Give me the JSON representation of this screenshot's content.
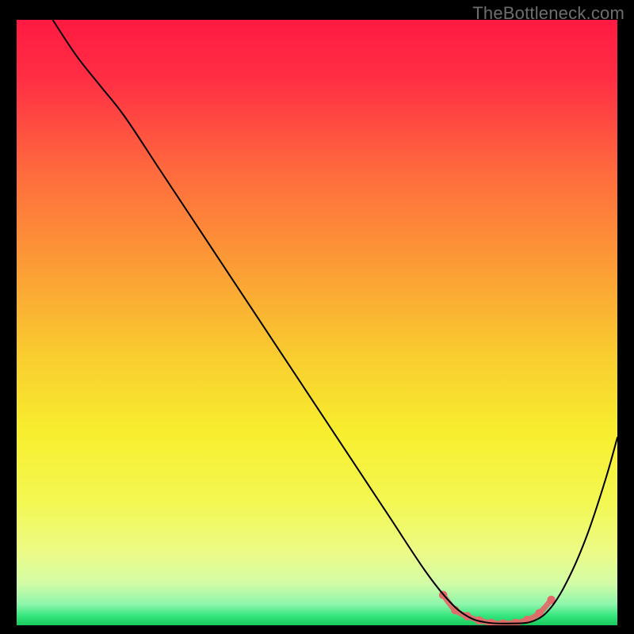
{
  "watermark": "TheBottleneck.com",
  "chart_data": {
    "type": "line",
    "title": "",
    "xlabel": "",
    "ylabel": "",
    "xlim": [
      0,
      100
    ],
    "ylim": [
      0,
      100
    ],
    "background_gradient": {
      "stops": [
        {
          "offset": 0.0,
          "color": "#ff1a42"
        },
        {
          "offset": 0.1,
          "color": "#ff2f44"
        },
        {
          "offset": 0.25,
          "color": "#ff6a3e"
        },
        {
          "offset": 0.4,
          "color": "#fc9a36"
        },
        {
          "offset": 0.55,
          "color": "#f9cb2f"
        },
        {
          "offset": 0.68,
          "color": "#f8ee2e"
        },
        {
          "offset": 0.8,
          "color": "#f3f854"
        },
        {
          "offset": 0.88,
          "color": "#ecfb87"
        },
        {
          "offset": 0.93,
          "color": "#d4fca5"
        },
        {
          "offset": 0.965,
          "color": "#8ef6ab"
        },
        {
          "offset": 0.985,
          "color": "#33e57c"
        },
        {
          "offset": 1.0,
          "color": "#18c95c"
        }
      ]
    },
    "series": [
      {
        "name": "bottleneck-curve",
        "color": "#000000",
        "width": 2,
        "x": [
          6.0,
          10.0,
          14.0,
          18.0,
          24.0,
          32.0,
          40.0,
          48.0,
          56.0,
          62.0,
          68.0,
          72.0,
          75.0,
          78.0,
          82.0,
          86.0,
          89.0,
          92.0,
          95.0,
          98.0,
          100.0
        ],
        "y": [
          100.0,
          94.0,
          89.0,
          84.0,
          75.0,
          63.0,
          51.0,
          39.0,
          27.0,
          18.0,
          9.0,
          4.0,
          1.5,
          0.5,
          0.3,
          0.7,
          3.0,
          8.0,
          15.0,
          24.0,
          31.0
        ]
      }
    ],
    "highlight": {
      "name": "optimal-zone",
      "color": "#e26a6a",
      "width": 7,
      "x": [
        71.0,
        73.0,
        75.0,
        77.0,
        79.0,
        81.0,
        83.0,
        85.0,
        87.0,
        89.0
      ],
      "y": [
        5.0,
        2.5,
        1.5,
        0.8,
        0.4,
        0.3,
        0.4,
        0.9,
        2.0,
        4.2
      ]
    }
  }
}
